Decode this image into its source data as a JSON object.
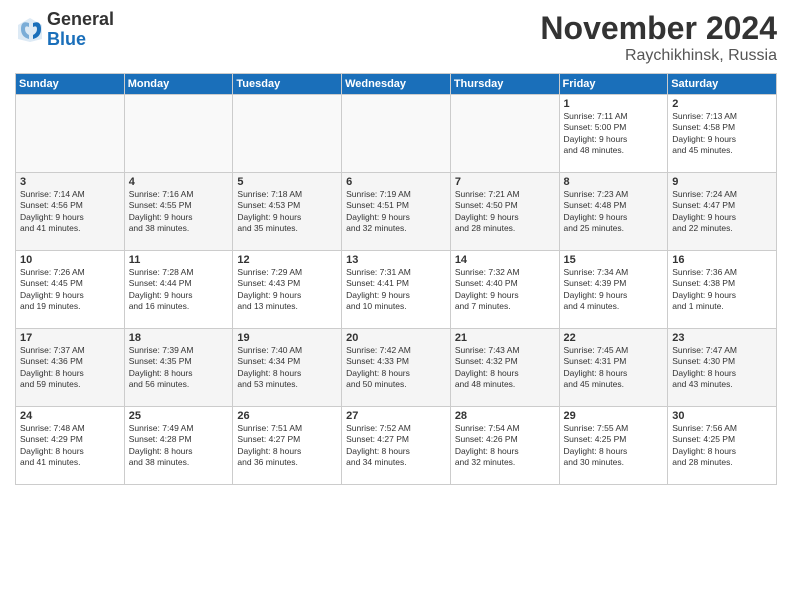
{
  "logo": {
    "general": "General",
    "blue": "Blue"
  },
  "title": "November 2024",
  "location": "Raychikhinsk, Russia",
  "headers": [
    "Sunday",
    "Monday",
    "Tuesday",
    "Wednesday",
    "Thursday",
    "Friday",
    "Saturday"
  ],
  "weeks": [
    [
      {
        "day": "",
        "info": ""
      },
      {
        "day": "",
        "info": ""
      },
      {
        "day": "",
        "info": ""
      },
      {
        "day": "",
        "info": ""
      },
      {
        "day": "",
        "info": ""
      },
      {
        "day": "1",
        "info": "Sunrise: 7:11 AM\nSunset: 5:00 PM\nDaylight: 9 hours\nand 48 minutes."
      },
      {
        "day": "2",
        "info": "Sunrise: 7:13 AM\nSunset: 4:58 PM\nDaylight: 9 hours\nand 45 minutes."
      }
    ],
    [
      {
        "day": "3",
        "info": "Sunrise: 7:14 AM\nSunset: 4:56 PM\nDaylight: 9 hours\nand 41 minutes."
      },
      {
        "day": "4",
        "info": "Sunrise: 7:16 AM\nSunset: 4:55 PM\nDaylight: 9 hours\nand 38 minutes."
      },
      {
        "day": "5",
        "info": "Sunrise: 7:18 AM\nSunset: 4:53 PM\nDaylight: 9 hours\nand 35 minutes."
      },
      {
        "day": "6",
        "info": "Sunrise: 7:19 AM\nSunset: 4:51 PM\nDaylight: 9 hours\nand 32 minutes."
      },
      {
        "day": "7",
        "info": "Sunrise: 7:21 AM\nSunset: 4:50 PM\nDaylight: 9 hours\nand 28 minutes."
      },
      {
        "day": "8",
        "info": "Sunrise: 7:23 AM\nSunset: 4:48 PM\nDaylight: 9 hours\nand 25 minutes."
      },
      {
        "day": "9",
        "info": "Sunrise: 7:24 AM\nSunset: 4:47 PM\nDaylight: 9 hours\nand 22 minutes."
      }
    ],
    [
      {
        "day": "10",
        "info": "Sunrise: 7:26 AM\nSunset: 4:45 PM\nDaylight: 9 hours\nand 19 minutes."
      },
      {
        "day": "11",
        "info": "Sunrise: 7:28 AM\nSunset: 4:44 PM\nDaylight: 9 hours\nand 16 minutes."
      },
      {
        "day": "12",
        "info": "Sunrise: 7:29 AM\nSunset: 4:43 PM\nDaylight: 9 hours\nand 13 minutes."
      },
      {
        "day": "13",
        "info": "Sunrise: 7:31 AM\nSunset: 4:41 PM\nDaylight: 9 hours\nand 10 minutes."
      },
      {
        "day": "14",
        "info": "Sunrise: 7:32 AM\nSunset: 4:40 PM\nDaylight: 9 hours\nand 7 minutes."
      },
      {
        "day": "15",
        "info": "Sunrise: 7:34 AM\nSunset: 4:39 PM\nDaylight: 9 hours\nand 4 minutes."
      },
      {
        "day": "16",
        "info": "Sunrise: 7:36 AM\nSunset: 4:38 PM\nDaylight: 9 hours\nand 1 minute."
      }
    ],
    [
      {
        "day": "17",
        "info": "Sunrise: 7:37 AM\nSunset: 4:36 PM\nDaylight: 8 hours\nand 59 minutes."
      },
      {
        "day": "18",
        "info": "Sunrise: 7:39 AM\nSunset: 4:35 PM\nDaylight: 8 hours\nand 56 minutes."
      },
      {
        "day": "19",
        "info": "Sunrise: 7:40 AM\nSunset: 4:34 PM\nDaylight: 8 hours\nand 53 minutes."
      },
      {
        "day": "20",
        "info": "Sunrise: 7:42 AM\nSunset: 4:33 PM\nDaylight: 8 hours\nand 50 minutes."
      },
      {
        "day": "21",
        "info": "Sunrise: 7:43 AM\nSunset: 4:32 PM\nDaylight: 8 hours\nand 48 minutes."
      },
      {
        "day": "22",
        "info": "Sunrise: 7:45 AM\nSunset: 4:31 PM\nDaylight: 8 hours\nand 45 minutes."
      },
      {
        "day": "23",
        "info": "Sunrise: 7:47 AM\nSunset: 4:30 PM\nDaylight: 8 hours\nand 43 minutes."
      }
    ],
    [
      {
        "day": "24",
        "info": "Sunrise: 7:48 AM\nSunset: 4:29 PM\nDaylight: 8 hours\nand 41 minutes."
      },
      {
        "day": "25",
        "info": "Sunrise: 7:49 AM\nSunset: 4:28 PM\nDaylight: 8 hours\nand 38 minutes."
      },
      {
        "day": "26",
        "info": "Sunrise: 7:51 AM\nSunset: 4:27 PM\nDaylight: 8 hours\nand 36 minutes."
      },
      {
        "day": "27",
        "info": "Sunrise: 7:52 AM\nSunset: 4:27 PM\nDaylight: 8 hours\nand 34 minutes."
      },
      {
        "day": "28",
        "info": "Sunrise: 7:54 AM\nSunset: 4:26 PM\nDaylight: 8 hours\nand 32 minutes."
      },
      {
        "day": "29",
        "info": "Sunrise: 7:55 AM\nSunset: 4:25 PM\nDaylight: 8 hours\nand 30 minutes."
      },
      {
        "day": "30",
        "info": "Sunrise: 7:56 AM\nSunset: 4:25 PM\nDaylight: 8 hours\nand 28 minutes."
      }
    ]
  ]
}
